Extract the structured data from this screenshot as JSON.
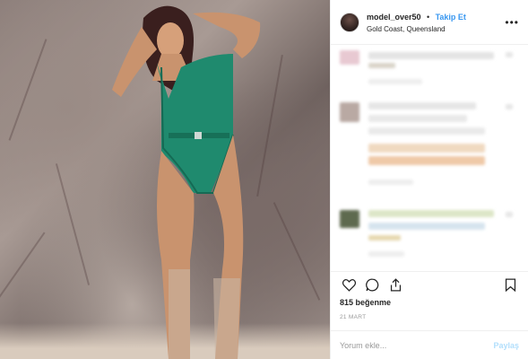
{
  "header": {
    "username": "model_over50",
    "separator": "•",
    "follow_label": "Takip Et",
    "location": "Gold Coast, Queensland",
    "more_icon": "more-horizontal-icon"
  },
  "photo": {
    "subject": "woman-in-green-swimsuit",
    "swimsuit_color": "#1f8a6e"
  },
  "actions": {
    "like_icon": "heart-icon",
    "comment_icon": "comment-icon",
    "share_icon": "share-icon",
    "save_icon": "bookmark-icon"
  },
  "likes_text": "815 beğenme",
  "date_text": "21 MART",
  "comment": {
    "placeholder": "Yorum ekle...",
    "post_label": "Paylaş"
  },
  "colors": {
    "link": "#3897f0",
    "post_disabled": "#b2dffc"
  }
}
